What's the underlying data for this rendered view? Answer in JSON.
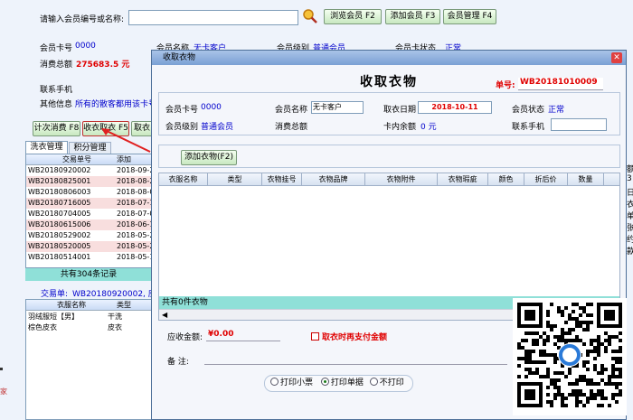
{
  "search": {
    "label": "请输入会员编号或名称:",
    "value": ""
  },
  "toolbar": {
    "browse": "浏览会员 F2",
    "add": "添加会员 F3",
    "manage": "会员管理 F4"
  },
  "member": {
    "card_label": "会员卡号",
    "card_value": "0000",
    "name_label": "会员名称",
    "name_value": "无卡客户",
    "level_label": "会员级别",
    "level_value": "普通会员",
    "status_label": "会员卡状态",
    "status_value": "正常",
    "total_label": "消费总额",
    "total_value": "275683.5 元",
    "phone_label": "联系手机",
    "other_label": "其他信息",
    "other_value": "所有的散客都用该卡号"
  },
  "actions": {
    "count": "计次消费 F8",
    "collect": "收衣取衣 F5",
    "pickup": "取衣"
  },
  "tabs": [
    "洗衣管理",
    "积分管理"
  ],
  "orders": {
    "headers": [
      "交易单号",
      "添加"
    ],
    "rows": [
      [
        "WB20180920002",
        "2018-09-2"
      ],
      [
        "WB20180825001",
        "2018-08-2"
      ],
      [
        "WB20180806003",
        "2018-08-0"
      ],
      [
        "WB20180716005",
        "2018-07-1"
      ],
      [
        "WB20180704005",
        "2018-07-0"
      ],
      [
        "WB20180615006",
        "2018-06-1"
      ],
      [
        "WB20180529002",
        "2018-05-2"
      ],
      [
        "WB20180520005",
        "2018-05-2"
      ],
      [
        "WB20180514001",
        "2018-05-1"
      ]
    ],
    "footer": "共有304条记录"
  },
  "transaction": {
    "label": "交易单:",
    "value": "WB20180920002, 应收金额"
  },
  "items": {
    "headers": [
      "衣服名称",
      "类型"
    ],
    "rows": [
      [
        "羽绒服短【男】",
        "干洗"
      ],
      [
        "棕色皮衣",
        "皮衣"
      ]
    ]
  },
  "right_chars": [
    "额",
    "3",
    "日",
    "衣",
    "单",
    "张",
    "约",
    "款"
  ],
  "left_glyph": "家",
  "modal": {
    "title": "收取衣物",
    "heading": "收取衣物",
    "order_label": "单号:",
    "order_value": "WB20181010009",
    "card_label": "会员卡号",
    "card_value": "0000",
    "name_label": "会员名称",
    "name_value": "无卡客户",
    "date_label": "取衣日期",
    "date_value": "2018-10-11",
    "status_label": "会员状态",
    "status_value": "正常",
    "level_label": "会员级别",
    "level_value": "普通会员",
    "total_label": "消费总额",
    "total_value": "",
    "balance_label": "卡内余额",
    "balance_value": "0 元",
    "phone_label": "联系手机",
    "phone_value": "",
    "add_btn": "添加衣物(F2)",
    "grid_headers": [
      "衣服名称",
      "类型",
      "衣物挂号",
      "衣物品牌",
      "衣物附件",
      "衣物瑕疵",
      "颜色",
      "折后价",
      "数量"
    ],
    "grid_footer": "共有0件衣物",
    "amount_label": "应收金额:",
    "amount_value": "¥0.00",
    "pay_check_label": "取衣时再支付金额",
    "remark_label": "备    注:",
    "print_options": [
      "打印小票",
      "打印单据",
      "不打印"
    ],
    "print_selected": 1
  },
  "colors": {
    "accent_blue": "#0000cc",
    "accent_red": "#e00000",
    "row_highlight": "#f8dede",
    "title_bar": "#7aa0d4"
  }
}
